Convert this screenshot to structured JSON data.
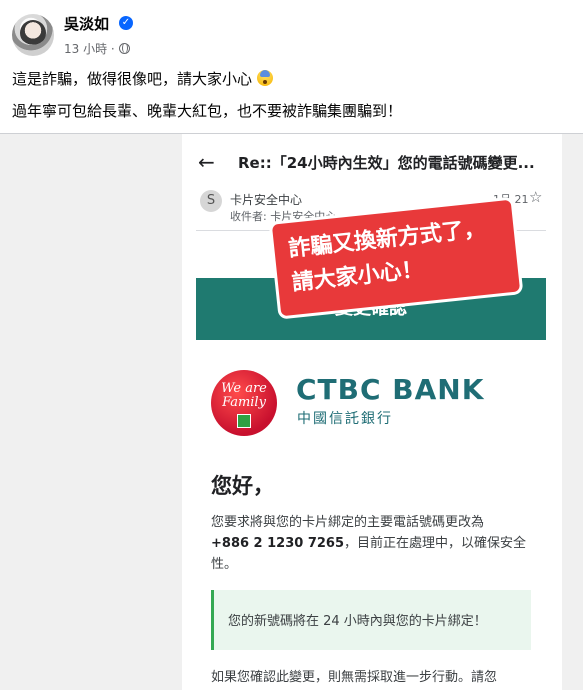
{
  "post": {
    "author": "吳淡如",
    "time": "13 小時 ·",
    "text_line1": "這是詐騙，做得很像吧，請大家小心",
    "text_line2": "過年寧可包給長輩、晚輩大紅包，也不要被詐騙集團騙到！"
  },
  "icons": [
    "verified-badge-icon",
    "globe-icon",
    "anxious-face-emoji-icon",
    "back-arrow-icon",
    "star-icon"
  ],
  "email": {
    "subject": "Re::「24小時內生效」您的電話號碼變更...",
    "sender": "卡片安全中心",
    "recipient": "收件者: 卡片安全中心 ⌄",
    "date": "1月 21",
    "confirm_label": "變更確認",
    "bank_logo_text": "We are Family",
    "bank_name_en": "CTBC BANK",
    "bank_name_zh": "中國信託銀行",
    "greeting": "您好，",
    "body_prefix": "您要求將與您的卡片綁定的主要電話號碼更改為",
    "phone": "+886 2 1230 7265",
    "body_suffix": "，目前正在處理中，以確保安全性。",
    "notice": "您的新號碼將在 24 小時內與您的卡片綁定！",
    "body2": "如果您確認此變更，則無需採取進一步行動。請忽"
  },
  "sticker": {
    "line1": "詐騙又換新方式了，",
    "line2": "請大家小心！"
  },
  "colors": {
    "facebook_blue": "#0866ff",
    "bank_teal": "#1f6d75",
    "banner_teal": "#1f7a70",
    "sticker_red": "#e8393a",
    "notice_green": "#34a853"
  }
}
